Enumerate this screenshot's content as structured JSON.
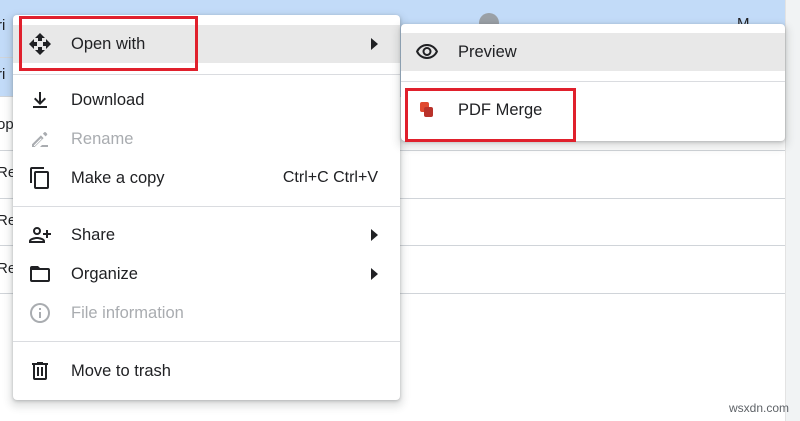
{
  "background": {
    "rows": [
      "ri",
      "ri",
      "op",
      "Re",
      "Re",
      "Re"
    ],
    "right_text": "M"
  },
  "menu": {
    "open_with": "Open with",
    "download": "Download",
    "rename": "Rename",
    "make_copy": "Make a copy",
    "make_copy_shortcut": "Ctrl+C Ctrl+V",
    "share": "Share",
    "organize": "Organize",
    "file_information": "File information",
    "move_to_trash": "Move to trash"
  },
  "submenu": {
    "preview": "Preview",
    "pdf_merge": "PDF Merge"
  },
  "colors": {
    "highlight": "#e0202c",
    "selected_row": "#c2dbf8",
    "hover_item": "#e8e8e8",
    "pdf_merge_icon": "#d24a33"
  },
  "watermark": "wsxdn.com"
}
